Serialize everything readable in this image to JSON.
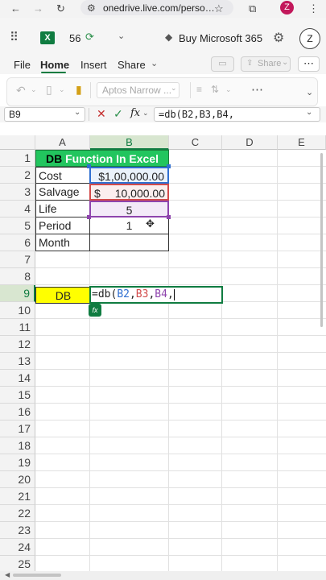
{
  "browser": {
    "url": "onedrive.live.com/perso…",
    "profile_initial": "Z",
    "icons": [
      "back-arrow-icon",
      "forward-arrow-icon",
      "reload-icon",
      "site-info-icon",
      "star-icon",
      "extensions-icon",
      "menu-dots-icon"
    ]
  },
  "app": {
    "autosave_count": "56",
    "buy_label": "Buy Microsoft 365",
    "profile_initial": "Z",
    "logo_letter": "X"
  },
  "ribbon": {
    "tabs": [
      "File",
      "Home",
      "Insert",
      "Share"
    ],
    "active_tab": "Home",
    "share_label": "Share",
    "font_name": "Aptos Narrow ..."
  },
  "formula_bar": {
    "name_box": "B9",
    "fx_label": "fx",
    "formula": "=db(B2,B3,B4,"
  },
  "grid": {
    "columns": [
      "A",
      "B",
      "C",
      "D",
      "E"
    ],
    "rows": [
      "1",
      "2",
      "3",
      "4",
      "5",
      "6",
      "7",
      "8",
      "9",
      "10",
      "11",
      "12",
      "13",
      "14",
      "15",
      "16",
      "17",
      "18",
      "19",
      "20",
      "21",
      "22",
      "23",
      "24",
      "25"
    ],
    "title": "DB Function In Excel",
    "title_prefix": "DB",
    "title_rest": "Function In Excel",
    "labels": [
      "Cost",
      "Salvage",
      "Life",
      "Period",
      "Month"
    ],
    "b2": "$1,00,000.00",
    "b3_symbol": "$",
    "b3_value": "10,000.00",
    "b4": "5",
    "b5": "1",
    "a9": "DB",
    "b9_prefix": "=db(",
    "b9_ref1": "B2",
    "b9_ref2": "B3",
    "b9_ref3": "B4",
    "b9_comma": ",",
    "autocomplete_icon": "fx"
  },
  "colors": {
    "excel_green": "#107c41",
    "title_fill": "#22c55e",
    "db_fill": "#ffff00",
    "ref_blue": "#2f6fd1",
    "ref_red": "#d24a4a",
    "ref_purple": "#8e44ad"
  }
}
